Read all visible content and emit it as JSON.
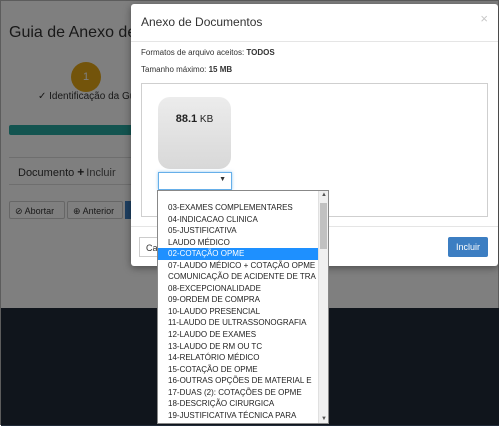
{
  "background": {
    "title": "Guia de Anexo de S",
    "step_number": "1",
    "step_label": "✓ Identificação da Gu",
    "documento_label": "Documento",
    "incluir_label": "Incluir",
    "abortar_label": "Abortar",
    "anterior_label": "Anterior"
  },
  "modal": {
    "title": "Anexo de Documentos",
    "close": "×",
    "formats_prefix": "Formatos de arquivo aceitos:",
    "formats_value": "TODOS",
    "maxsize_prefix": "Tamanho máximo:",
    "maxsize_value": "15 MB",
    "file_size_value": "88.1",
    "file_size_unit": "KB",
    "cancel_label": "Ca",
    "include_label": "Incluir"
  },
  "dropdown": {
    "selected_value": "",
    "items": [
      "03-EXAMES COMPLEMENTARES",
      "04-INDICACAO CLINICA",
      "05-JUSTIFICATIVA",
      "LAUDO MÉDICO",
      "02-COTAÇÃO OPME",
      "07-LAUDO MÉDICO + COTAÇÃO OPME",
      "COMUNICAÇÃO DE ACIDENTE DE TRA",
      "08-EXCEPCIONALIDADE",
      "09-ORDEM DE COMPRA",
      "10-LAUDO PRESENCIAL",
      "11-LAUDO DE ULTRASSONOGRAFIA",
      "12-LAUDO DE EXAMES",
      "13-LAUDO DE RM OU TC",
      "14-RELATÓRIO MÉDICO",
      "15-COTAÇÃO DE OPME",
      "16-OUTRAS OPÇÕES DE MATERIAL E",
      "17-DUAS (2): COTAÇÕES DE OPME",
      "18-DESCRIÇÃO CIRURGICA",
      "19-JUSTIFICATIVA TÉCNICA PARA"
    ],
    "selected_index": 4
  }
}
